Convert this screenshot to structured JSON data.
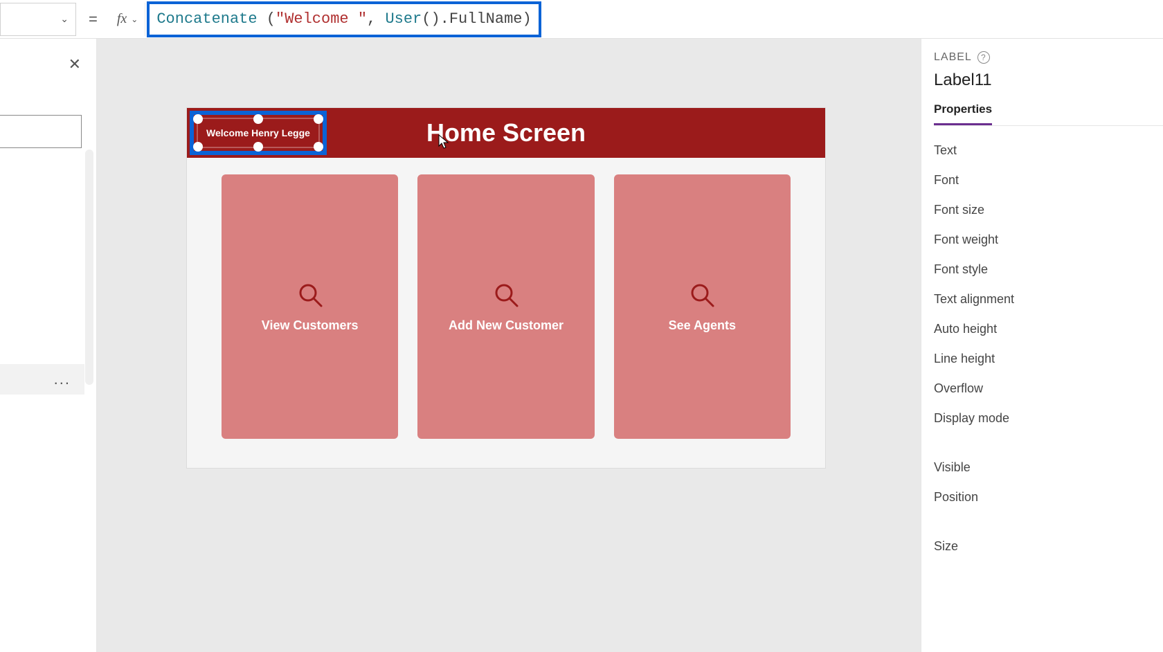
{
  "formula_bar": {
    "fx_label": "fx",
    "tokens": {
      "fn": "Concatenate",
      "open": " (",
      "str": "\"Welcome \"",
      "comma": ", ",
      "obj": "User",
      "call": "()",
      "dot": ".",
      "prop": "FullName",
      "close": ")"
    }
  },
  "left_panel": {
    "ellipsis": "..."
  },
  "canvas": {
    "header_title": "Home Screen",
    "selected_label_text": "Welcome Henry Legge",
    "cards": [
      {
        "label": "View Customers"
      },
      {
        "label": "Add New Customer"
      },
      {
        "label": "See Agents"
      }
    ]
  },
  "props": {
    "type_label": "LABEL",
    "control_name": "Label11",
    "tab": "Properties",
    "items": [
      "Text",
      "Font",
      "Font size",
      "Font weight",
      "Font style",
      "Text alignment",
      "Auto height",
      "Line height",
      "Overflow",
      "Display mode"
    ],
    "items2": [
      "Visible",
      "Position"
    ],
    "items3": [
      "Size"
    ]
  }
}
